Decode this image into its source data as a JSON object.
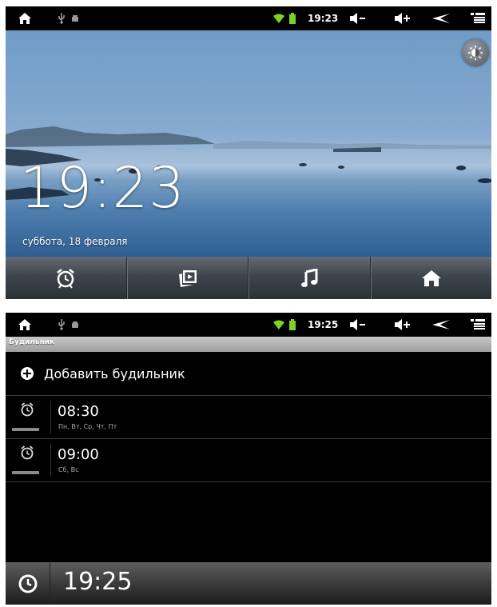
{
  "screen_home": {
    "status": {
      "time": "19:23"
    },
    "clock": {
      "time": "19:23",
      "date": "суббота, 18 февраля"
    },
    "dock": [
      "alarm-clock-icon",
      "gallery-icon",
      "music-icon",
      "home-icon"
    ]
  },
  "screen_alarms": {
    "status": {
      "time": "19:25"
    },
    "title": "Будильник",
    "add_label": "Добавить будильник",
    "alarms": [
      {
        "time": "08:30",
        "days": "Пн, Вт, Ср, Чт, Пт"
      },
      {
        "time": "09:00",
        "days": "Сб, Вс"
      }
    ],
    "bottom_time": "19:25"
  },
  "colors": {
    "wifi_battery": "#7ed321",
    "status_bg": "#000000"
  }
}
